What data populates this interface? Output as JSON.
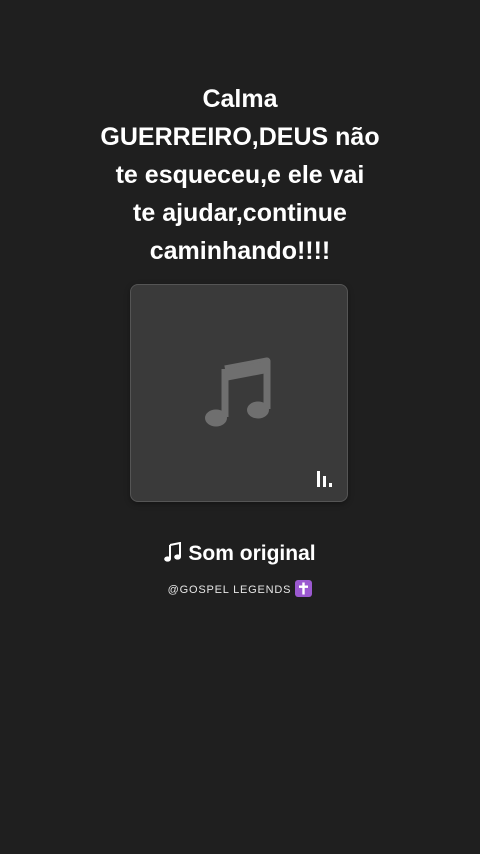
{
  "caption": {
    "lines": [
      "Calma",
      "GUERREIRO,DEUS não",
      "te esqueceu,e ele vai",
      "te ajudar,continue",
      "caminhando!!!!"
    ]
  },
  "cover": {
    "icon": "music-note-icon",
    "badge_icon": "audio-bars-icon"
  },
  "sound": {
    "icon": "music-note-icon",
    "title": "Som original"
  },
  "author": {
    "handle": "@GOSPEL LEGENDS",
    "badge_icon": "latin-cross-icon"
  },
  "colors": {
    "background": "#1f1f1f",
    "cover_bg": "#3a3a3a",
    "cover_icon": "#6f6f6f",
    "text": "#ffffff",
    "cross_badge": "#9b59d0"
  }
}
